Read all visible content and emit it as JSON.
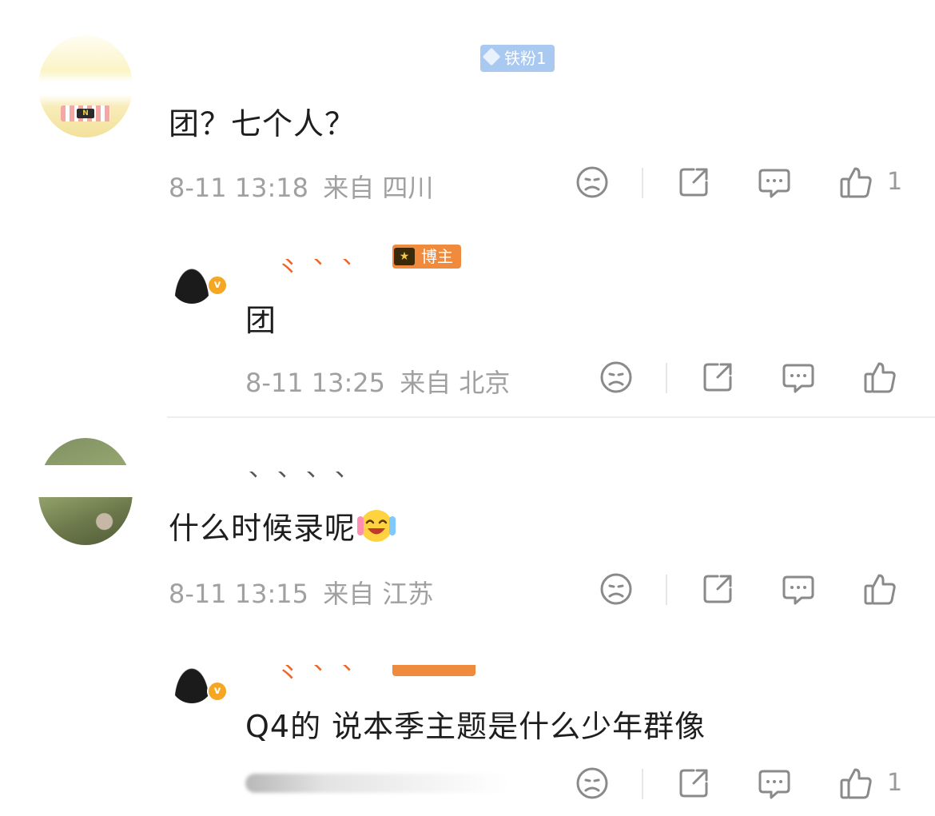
{
  "comments": [
    {
      "badge": "铁粉1",
      "text": "团？七个人？",
      "time": "8-11 13:18",
      "from": "来自",
      "location": "四川",
      "like_count": "1"
    },
    {
      "badge": "博主",
      "text": "团",
      "time": "8-11 13:25",
      "from": "来自",
      "location": "北京",
      "like_count": ""
    },
    {
      "text": "什么时候录呢",
      "emoji": "laughing-crying-emoji",
      "time": "8-11 13:15",
      "from": "来自",
      "location": "江苏",
      "like_count": ""
    },
    {
      "text": "Q4的 说本季主题是什么少年群像",
      "like_count": "1"
    }
  ],
  "icons": {
    "dislike": "sad-face-icon",
    "share": "share-icon",
    "reply": "comment-icon",
    "like": "thumbs-up-icon"
  },
  "colors": {
    "fan_badge": "#a9c9f0",
    "blogger_badge": "#f08a3c",
    "verified": "#f5a623",
    "meta_text": "#a0a0a0"
  }
}
